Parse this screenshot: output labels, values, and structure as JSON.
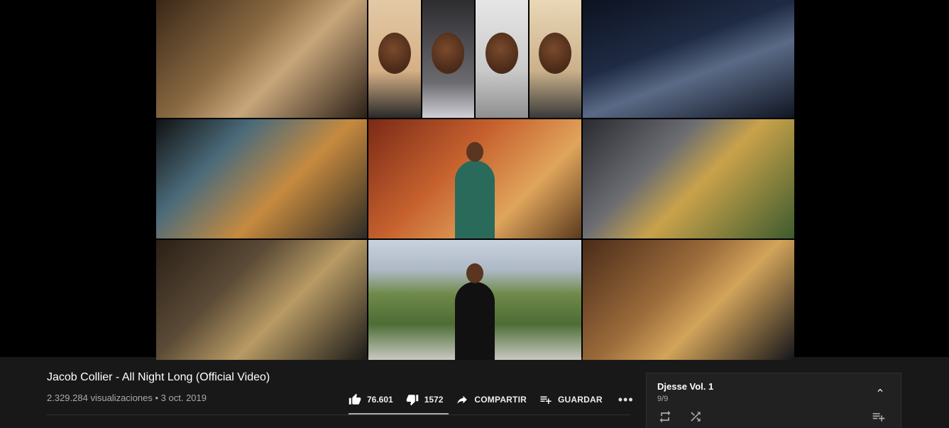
{
  "video": {
    "title": "Jacob Collier - All Night Long (Official Video)",
    "views": "2.329.284 visualizaciones",
    "separator": " • ",
    "date": "3 oct. 2019"
  },
  "actions": {
    "likes": "76.601",
    "dislikes": "1572",
    "share_label": "COMPARTIR",
    "save_label": "GUARDAR",
    "more_label": "•••"
  },
  "playlist": {
    "title": "Djesse Vol. 1",
    "position": "9/9"
  },
  "icons": {
    "like": "thumb-up-icon",
    "dislike": "thumb-down-icon",
    "share": "share-arrow-icon",
    "save": "playlist-add-icon",
    "collapse": "chevron-up-icon",
    "loop": "loop-icon",
    "shuffle": "shuffle-icon",
    "add": "playlist-add-icon"
  },
  "colors": {
    "background": "#181818",
    "player": "#000000",
    "secondary_text": "#aaaaaa"
  }
}
